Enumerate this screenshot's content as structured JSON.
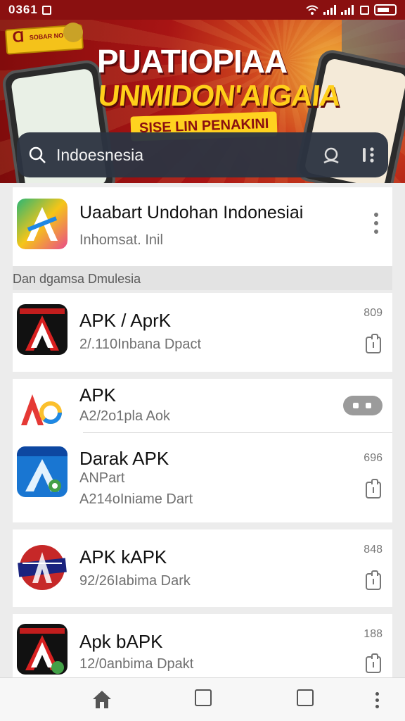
{
  "status_bar": {
    "time": "0361"
  },
  "banner": {
    "badge_text": "SOBAR NOTAN",
    "headline_1": "PUATIOPIAA",
    "headline_2": "UNMIDON'AIGAIA",
    "tagline": "SISE LIN PENAKINI"
  },
  "search": {
    "query": "Indoesnesia"
  },
  "featured": {
    "title": "Uaabart Undohan Indonesiai",
    "subtitle": "Inhomsat. Inil"
  },
  "section_header": "Dan dgamsa Dmulesia",
  "apps": [
    {
      "title": "APK / AprK",
      "subtitle": "2/.110Inbana Dpact",
      "meta": "809"
    },
    {
      "title": "APK",
      "subtitle": "A2/2o1pla Aok"
    },
    {
      "title": "Darak APK",
      "subtitle": "ANPart",
      "subtitle_2": "A214oIniame Dart",
      "meta": "696"
    },
    {
      "title": "APK kAPK",
      "subtitle": "92/26Iabima Dark",
      "meta": "848"
    },
    {
      "title": "Apk bAPK",
      "subtitle": "12/0anbima Dpakt",
      "meta": "188"
    }
  ],
  "colors": {
    "brand_red": "#8a1010",
    "banner_yellow": "#ffd21f",
    "search_bg": "#2d3442"
  }
}
